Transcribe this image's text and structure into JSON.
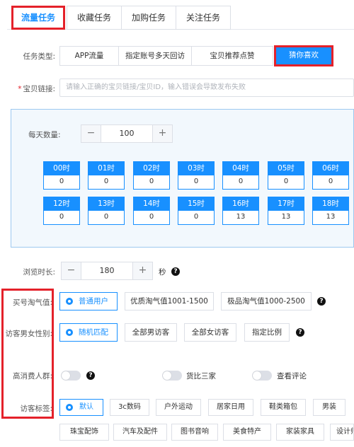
{
  "tabs": [
    {
      "label": "流量任务",
      "active": true
    },
    {
      "label": "收藏任务"
    },
    {
      "label": "加购任务"
    },
    {
      "label": "关注任务"
    }
  ],
  "task_type": {
    "label": "任务类型:",
    "options": [
      "APP流量",
      "指定账号多天回访",
      "宝贝推荐点赞",
      "猜你喜欢"
    ]
  },
  "url": {
    "required_mark": "*",
    "label": "宝贝链接:",
    "placeholder": "请输入正确的宝贝链接/宝贝ID，输入错误会导致发布失败"
  },
  "daily": {
    "label": "每天数量:",
    "minus": "−",
    "plus": "+",
    "value": "100"
  },
  "hours_row1": [
    {
      "h": "00时",
      "v": "0"
    },
    {
      "h": "01时",
      "v": "0"
    },
    {
      "h": "02时",
      "v": "0"
    },
    {
      "h": "03时",
      "v": "0"
    },
    {
      "h": "04时",
      "v": "0"
    },
    {
      "h": "05时",
      "v": "0"
    },
    {
      "h": "06时",
      "v": "0"
    }
  ],
  "hours_row2": [
    {
      "h": "12时",
      "v": "0"
    },
    {
      "h": "13时",
      "v": "0"
    },
    {
      "h": "14时",
      "v": "0"
    },
    {
      "h": "15时",
      "v": "0"
    },
    {
      "h": "16时",
      "v": "13"
    },
    {
      "h": "17时",
      "v": "13"
    },
    {
      "h": "18时",
      "v": "13"
    }
  ],
  "browse": {
    "label": "浏览时长:",
    "minus": "−",
    "plus": "+",
    "value": "180",
    "unit": "秒",
    "help": "?"
  },
  "taoqi": {
    "label": "买号淘气值:",
    "options": [
      "普通用户",
      "优质淘气值1001-1500",
      "极品淘气值1000-2500"
    ],
    "help": "?"
  },
  "gender": {
    "label": "访客男女性别:",
    "options": [
      "随机匹配",
      "全部男访客",
      "全部女访客",
      "指定比例"
    ],
    "help": "?"
  },
  "high_consumer": {
    "label": "高消费人群:",
    "help": "?",
    "compare_label": "货比三家",
    "comment_label": "查看评论"
  },
  "visitor_tags": {
    "label": "访客标签:",
    "row1": [
      "默认",
      "3c数码",
      "户外运动",
      "居家日用",
      "鞋类箱包",
      "男装"
    ],
    "row2": [
      "珠宝配饰",
      "汽车及配件",
      "图书音响",
      "美食特产",
      "家装家具",
      "设计师"
    ]
  },
  "colors": {
    "accent": "#1890ff",
    "highlight": "#e4212a",
    "panel_bg": "#f2f8fd"
  }
}
